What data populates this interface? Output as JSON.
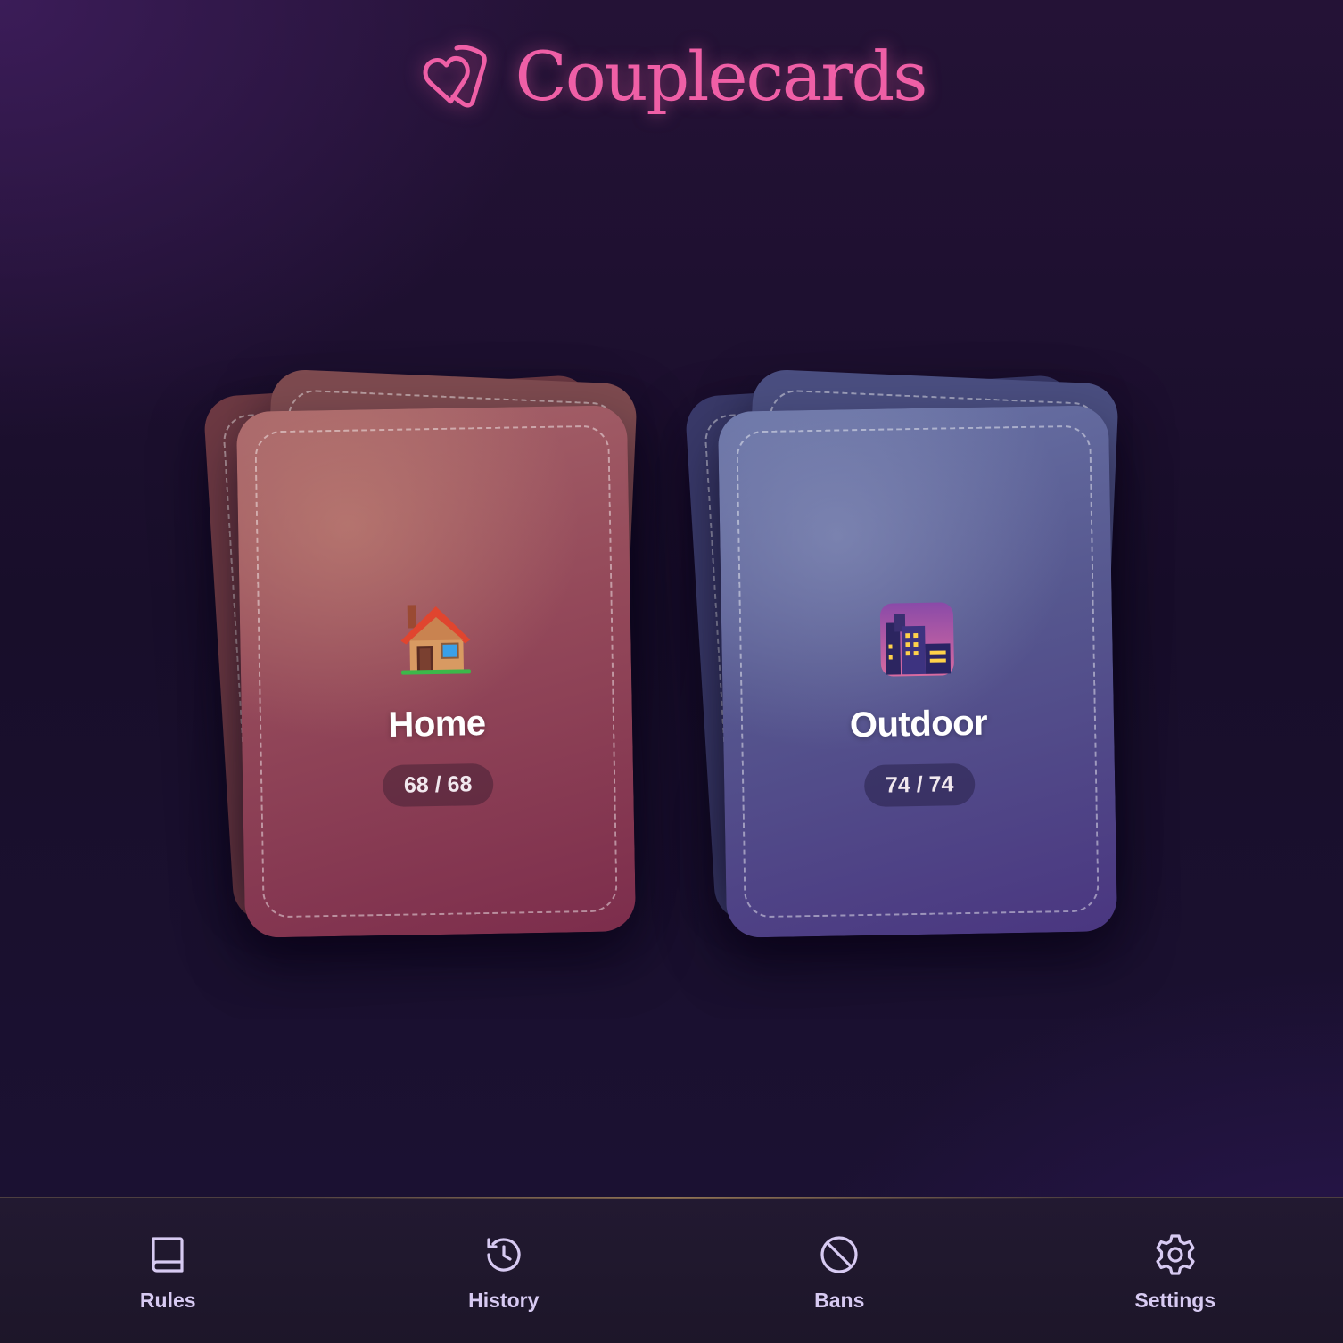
{
  "app": {
    "title": "Couplecards",
    "logo_icon": "overlapping-hearts-icon",
    "accent_color": "#ef5fa6"
  },
  "decks": [
    {
      "name": "Home",
      "icon": "house-emoji",
      "count": "68 / 68",
      "color": "#94495a"
    },
    {
      "name": "Outdoor",
      "icon": "night-city-emoji",
      "count": "74 / 74",
      "color": "#56578f"
    }
  ],
  "nav": {
    "items": [
      {
        "label": "Rules",
        "icon": "book-icon"
      },
      {
        "label": "History",
        "icon": "history-icon"
      },
      {
        "label": "Bans",
        "icon": "ban-icon"
      },
      {
        "label": "Settings",
        "icon": "gear-icon"
      }
    ]
  }
}
